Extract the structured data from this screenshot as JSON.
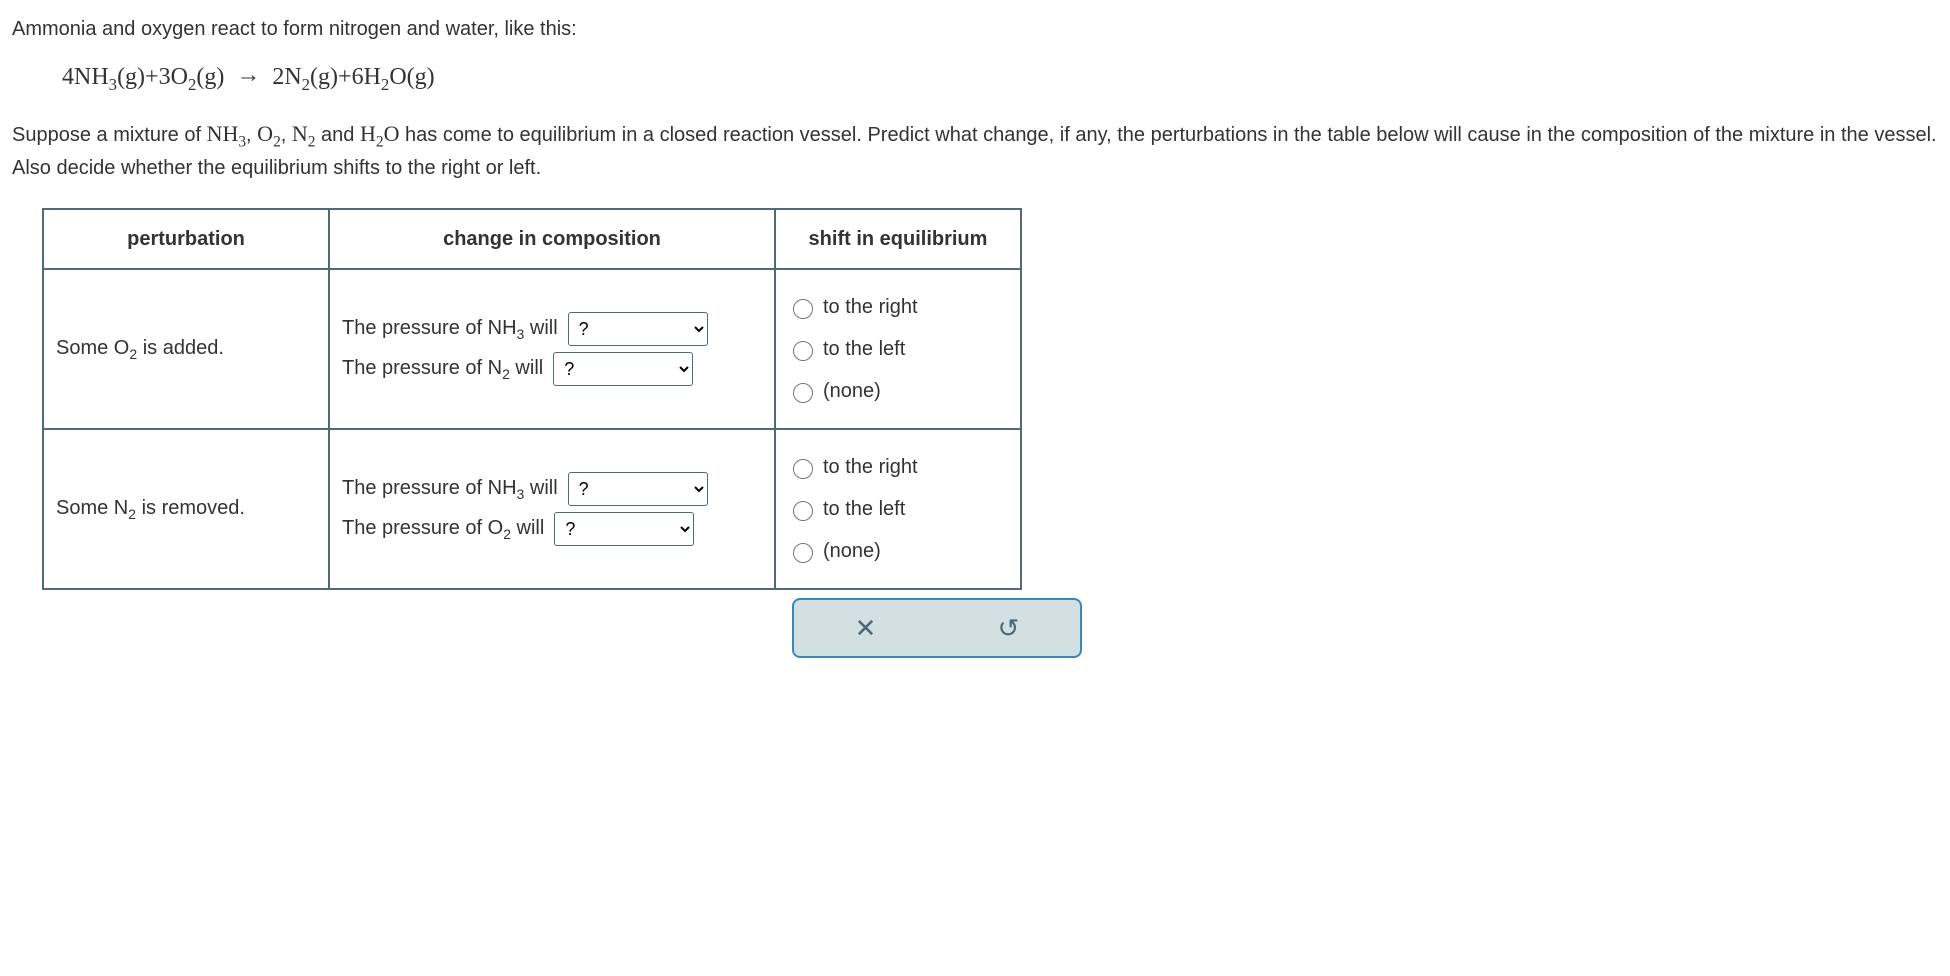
{
  "intro_line": "Ammonia and oxygen react to form nitrogen and water, like this:",
  "equation": {
    "lhs1_coef": "4NH",
    "lhs1_sub": "3",
    "lhs1_state": "(g)",
    "plus1": "+",
    "lhs2_coef": "3O",
    "lhs2_sub": "2",
    "lhs2_state": "(g)",
    "arrow": "→",
    "rhs1_coef": "2N",
    "rhs1_sub": "2",
    "rhs1_state": "(g)",
    "plus2": "+",
    "rhs2_coef": "6H",
    "rhs2_sub": "2",
    "rhs2_tail": "O(g)"
  },
  "body_pre": "Suppose a mixture of ",
  "body_species": {
    "s1": "NH",
    "s1sub": "3",
    "s2": "O",
    "s2sub": "2",
    "s3": "N",
    "s3sub": "2",
    "s4": "H",
    "s4sub": "2",
    "s4tail": "O"
  },
  "body_mid": " has come to equilibrium in a closed reaction vessel. Predict what change, if any, the perturbations in the table below will cause in the composition of the mixture in the vessel. Also decide whether the equilibrium shifts to the right or left.",
  "headers": {
    "pert": "perturbation",
    "change": "change in composition",
    "shift": "shift in equilibrium"
  },
  "rows": [
    {
      "pert_pre": "Some O",
      "pert_sub": "2",
      "pert_post": " is added.",
      "c1_pre": "The pressure of NH",
      "c1_sub": "3",
      "c1_post": " will",
      "c2_pre": "The pressure of N",
      "c2_sub": "2",
      "c2_post": " will"
    },
    {
      "pert_pre": "Some N",
      "pert_sub": "2",
      "pert_post": " is removed.",
      "c1_pre": "The pressure of NH",
      "c1_sub": "3",
      "c1_post": " will",
      "c2_pre": "The pressure of O",
      "c2_sub": "2",
      "c2_post": " will"
    }
  ],
  "select_placeholder": "?",
  "radio_options": {
    "right": "to the right",
    "left": "to the left",
    "none": "(none)"
  },
  "buttons": {
    "close": "✕",
    "reset": "↺"
  },
  "commas": ", ",
  "and": " and "
}
